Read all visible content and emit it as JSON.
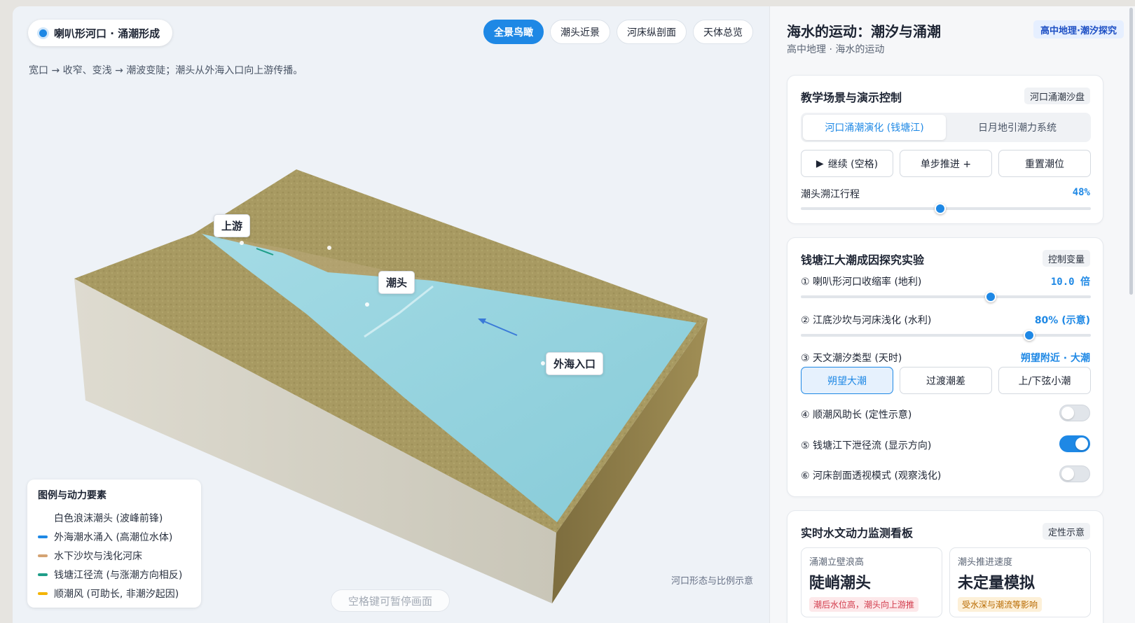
{
  "scene": {
    "title": "喇叭形河口 · 涌潮形成",
    "description": "宽口 → 收窄、变浅 → 潮波变陡；潮头从外海入口向上游传播。",
    "view_tabs": [
      {
        "label": "全景鸟瞰",
        "active": true
      },
      {
        "label": "潮头近景",
        "active": false
      },
      {
        "label": "河床纵剖面",
        "active": false
      },
      {
        "label": "天体总览",
        "active": false
      }
    ],
    "labels": {
      "upstream": "上游",
      "tidal_head": "潮头",
      "sea_entrance": "外海入口"
    },
    "legend": {
      "title": "图例与动力要素",
      "items": [
        {
          "label": "白色浪沫潮头 (波峰前锋)",
          "color": "#ffffff"
        },
        {
          "label": "外海潮水涌入 (高潮位水体)",
          "color": "#1e88e5"
        },
        {
          "label": "水下沙坎与浅化河床",
          "color": "#d4a373"
        },
        {
          "label": "钱塘江径流 (与涨潮方向相反)",
          "color": "#1f9e89"
        },
        {
          "label": "顺潮风 (可助长, 非潮汐起因)",
          "color": "#f4b400"
        }
      ]
    },
    "scale_note": "河口形态与比例示意",
    "pause_hint": "空格键可暂停画面",
    "colors": {
      "water": "#8fd0dc",
      "land": "#a89a62",
      "base": "#d6d4c8",
      "accent": "#1e88e5"
    }
  },
  "panel": {
    "title": "海水的运动：潮汐与涌潮",
    "subtitle": "高中地理 · 海水的运动",
    "badge": "高中地理·潮汐探究",
    "scenario": {
      "title": "教学场景与演示控制",
      "tag": "河口涌潮沙盘",
      "modes": [
        {
          "label": "河口涌潮演化 (钱塘江)",
          "active": true
        },
        {
          "label": "日月地引潮力系统",
          "active": false
        }
      ],
      "buttons": {
        "resume": "继续 (空格)",
        "step": "单步推进 +",
        "reset": "重置潮位"
      },
      "progress_label": "潮头溯江行程",
      "progress_value": "48%",
      "progress": 0.48
    },
    "experiment": {
      "title": "钱塘江大潮成因探究实验",
      "tag": "控制变量",
      "contraction_label": "① 喇叭形河口收缩率 (地利)",
      "contraction_value": "10.0 倍",
      "contraction": 0.66,
      "shoal_label": "② 江底沙坎与河床浅化 (水利)",
      "shoal_value": "80% (示意)",
      "shoal": 0.8,
      "tide_label": "③ 天文潮汐类型 (天时)",
      "tide_value": "朔望附近 · 大潮",
      "tide_options": [
        {
          "label": "朔望大潮",
          "active": true
        },
        {
          "label": "过渡潮差",
          "active": false
        },
        {
          "label": "上/下弦小潮",
          "active": false
        }
      ],
      "toggles": [
        {
          "label": "④ 顺潮风助长 (定性示意)",
          "on": false
        },
        {
          "label": "⑤ 钱塘江下泄径流 (显示方向)",
          "on": true
        },
        {
          "label": "⑥ 河床剖面透视模式 (观察浅化)",
          "on": false
        }
      ]
    },
    "monitor": {
      "title": "实时水文动力监测看板",
      "tag": "定性示意",
      "metrics": [
        {
          "name": "涌潮立壁浪高",
          "value": "陡峭潮头",
          "badge": "潮后水位高，潮头向上游推"
        },
        {
          "name": "潮头推进速度",
          "value": "未定量模拟",
          "badge": "受水深与潮流等影响"
        }
      ]
    }
  }
}
